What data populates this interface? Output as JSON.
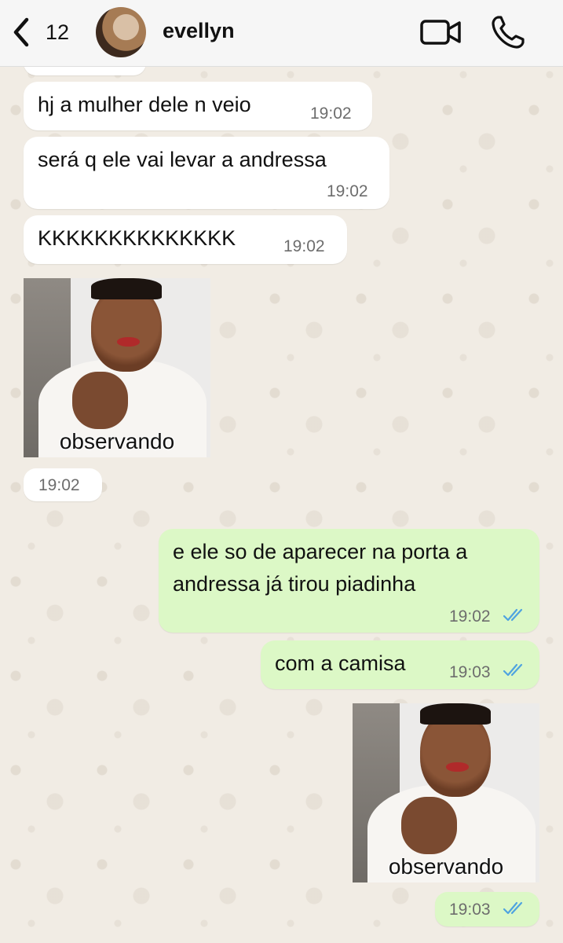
{
  "header": {
    "unread_count": "12",
    "contact_name": "evellyn"
  },
  "messages": [
    {
      "text": "hj a mulher dele n veio",
      "time": "19:02",
      "direction": "incoming"
    },
    {
      "text": "será q ele vai levar a andressa",
      "time": "19:02",
      "direction": "incoming"
    },
    {
      "text": "KKKKKKKKKKKKKK",
      "time": "19:02",
      "direction": "incoming"
    },
    {
      "sticker_caption": "observando",
      "time": "19:02",
      "direction": "incoming"
    },
    {
      "text_lines": [
        "e ele so de aparecer na porta a",
        "andressa já tirou piadinha"
      ],
      "time": "19:02",
      "direction": "outgoing"
    },
    {
      "text": "com a camisa",
      "time": "19:03",
      "direction": "outgoing"
    },
    {
      "sticker_caption": "observando",
      "time": "19:03",
      "direction": "outgoing"
    }
  ],
  "colors": {
    "header_bg": "#f6f6f6",
    "chat_bg": "#f1ece4",
    "incoming_bubble": "#ffffff",
    "outgoing_bubble": "#dcf8c6",
    "read_ticks": "#4fa3e0"
  },
  "icons": {
    "back": "chevron-left-icon",
    "video": "video-camera-icon",
    "call": "phone-icon",
    "read_status": "double-check-icon"
  }
}
